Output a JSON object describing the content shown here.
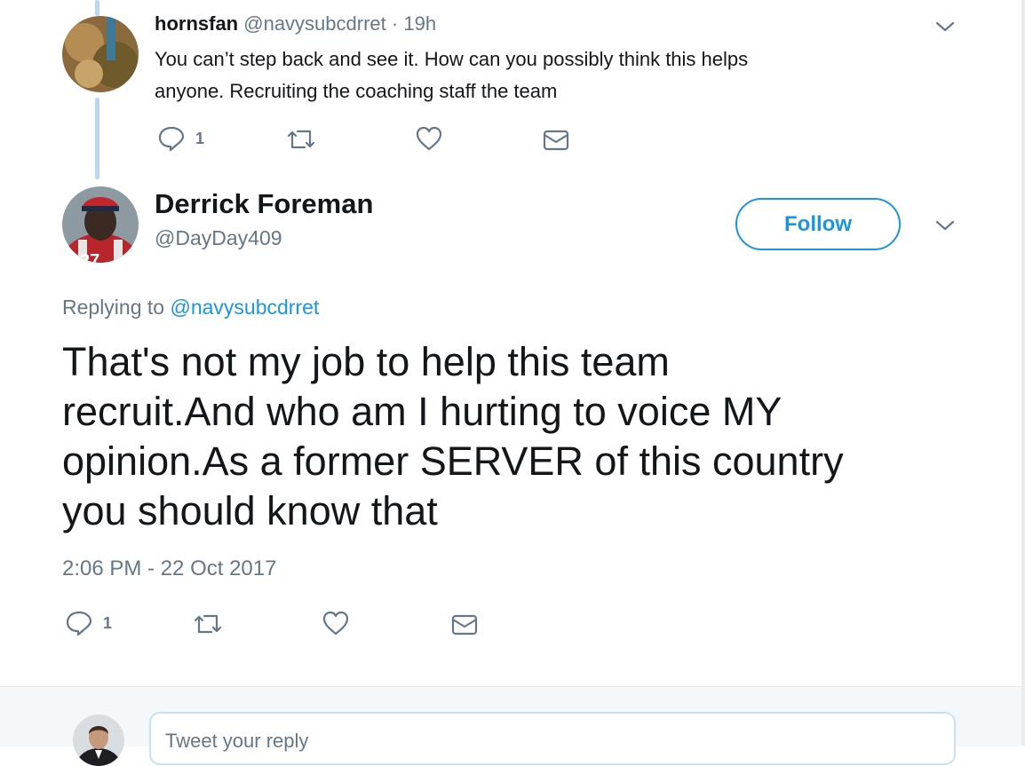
{
  "parent_tweet": {
    "display_name": "hornsfan",
    "handle": "@navysubcdrret",
    "separator": "·",
    "time": "19h",
    "text_line1": "You can’t step back and see it.  How can you possibly think this helps",
    "text_line2": "anyone.  Recruiting the coaching staff the team",
    "reply_count": "1"
  },
  "main_tweet": {
    "display_name": "Derrick Foreman",
    "handle": "@DayDay409",
    "follow_label": "Follow",
    "replying_prefix": "Replying to",
    "replying_handle": "@navysubcdrret",
    "text_line1": "That's not my job to help this team",
    "text_line2": "recruit.And who am I hurting to voice MY",
    "text_line3": "opinion.As a former SERVER of this country",
    "text_line4": "you should know that",
    "timestamp": "2:06 PM - 22 Oct 2017",
    "reply_count": "1"
  },
  "composer": {
    "placeholder": "Tweet your reply"
  },
  "colors": {
    "accent": "#1b95e0",
    "muted": "#657786",
    "thread_line": "#b8d9f0"
  },
  "icons": [
    "reply-icon",
    "retweet-icon",
    "like-icon",
    "dm-icon",
    "chevron-down-icon"
  ]
}
